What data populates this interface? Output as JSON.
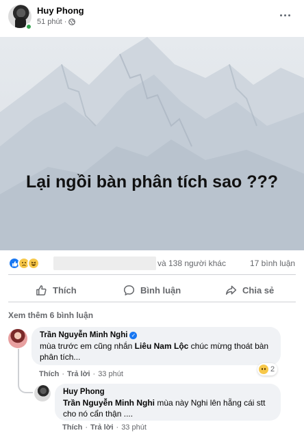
{
  "post": {
    "author": "Huy Phong",
    "time": "51 phút",
    "privacy_dot": "·",
    "image_text": "Lại ngồi bàn phân tích sao ???"
  },
  "reactions": {
    "icons": [
      "like-reaction-icon",
      "sad-reaction-icon",
      "haha-reaction-icon"
    ],
    "others": "và 138 người khác",
    "comments": "17 bình luận"
  },
  "actions": {
    "like": "Thích",
    "comment": "Bình luận",
    "share": "Chia sẻ"
  },
  "comments": {
    "see_more": "Xem thêm 6 bình luận",
    "items": [
      {
        "author": "Trần Nguyễn Minh Nghi",
        "text_before": "mùa trước em cũng nhắn ",
        "mention": "Liêu Nam Lộc",
        "text_after": " chúc mừng thoát bàn phân tích...",
        "like": "Thích",
        "reply": "Trả lời",
        "time": "33 phút",
        "reaction_count": "2"
      },
      {
        "author": "Huy Phong",
        "mention": "Trần Nguyễn Minh Nghi",
        "text_after": " mùa này Nghi lên hẵng cái stt cho nó cẩn thận ....",
        "like": "Thích",
        "reply": "Trả lời",
        "time": "33 phút"
      }
    ]
  },
  "colors": {
    "secondary_text": "#65676b",
    "comment_bubble": "#f0f2f5",
    "online": "#31a24c",
    "brand_blue": "#1877f2"
  }
}
